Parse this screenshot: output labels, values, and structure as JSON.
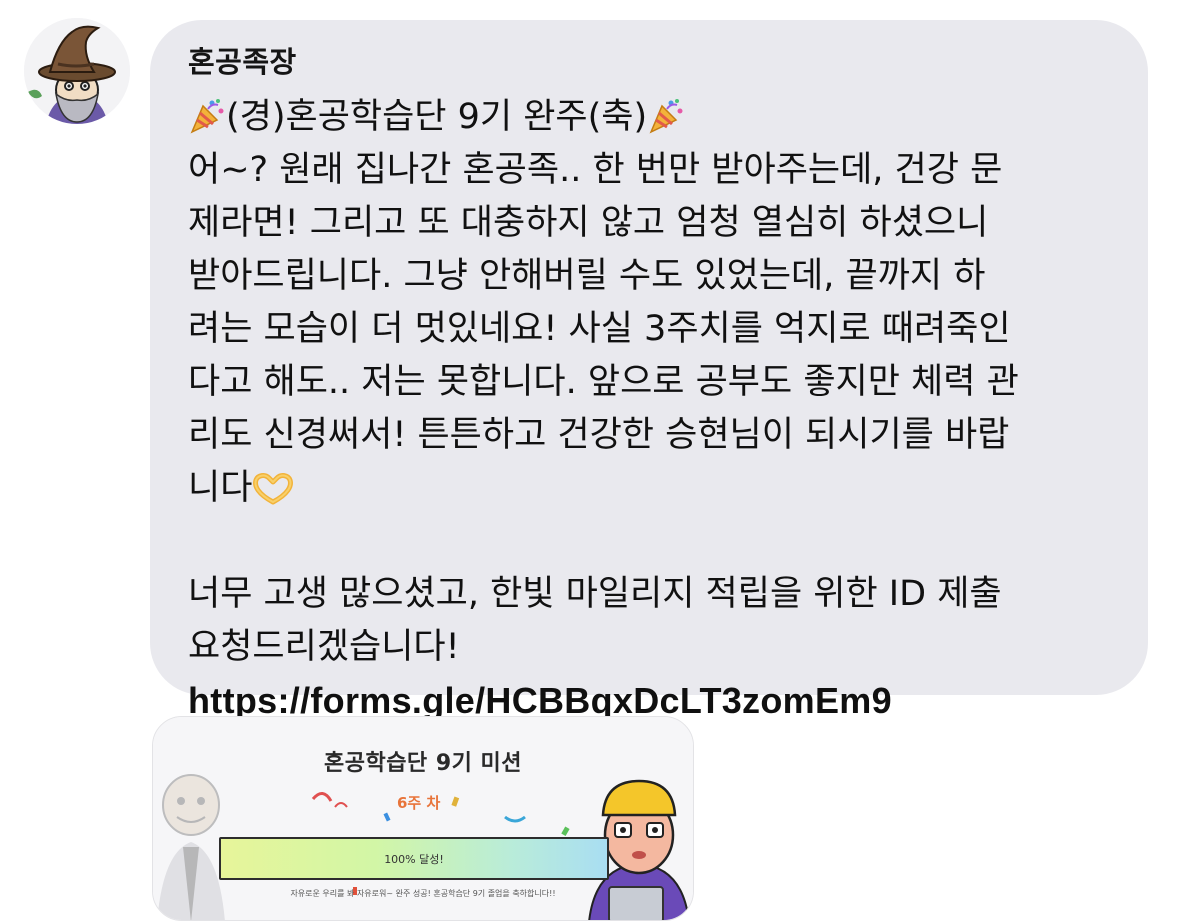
{
  "message": {
    "author": "혼공족장",
    "lines": [
      "(경)혼공학습단 9기 완주(축)",
      "어~? 원래 집나간 혼공족.. 한 번만 받아주는데, 건강 문",
      "제라면! 그리고 또 대충하지 않고 엄청 열심히 하셨으니",
      "받아드립니다. 그냥 안해버릴 수도 있었는데, 끝까지 하",
      "려는 모습이 더 멋있네요! 사실 3주치를 억지로 때려죽인",
      "다고 해도.. 저는 못합니다. 앞으로 공부도 좋지만 체력 관",
      "리도 신경써서! 튼튼하고 건강한 승현님이 되시기를 바랍",
      "니다"
    ],
    "lines2": [
      "너무 고생 많으셨고, 한빛 마일리지 적립을 위한 ID 제출",
      "요청드리겠습니다!"
    ],
    "link": "https://forms.gle/HCBBqxDcLT3zomEm9",
    "emojis": [
      "party-popper-icon",
      "heart-hands-icon"
    ]
  },
  "attachment": {
    "title": "혼공학습단 9기 미션",
    "week": "6주 차",
    "progress_text": "100% 달성!",
    "progress": 1.0,
    "caption": "자유로운 우리를 봐 자유로워~ 완주 성공! 혼공학습단 9기 졸업을 축하합니다!!"
  },
  "colors": {
    "bubble": "#e9e9ee",
    "text": "#111111",
    "progress_start": "#e7f59a",
    "progress_end": "#a9def2"
  }
}
